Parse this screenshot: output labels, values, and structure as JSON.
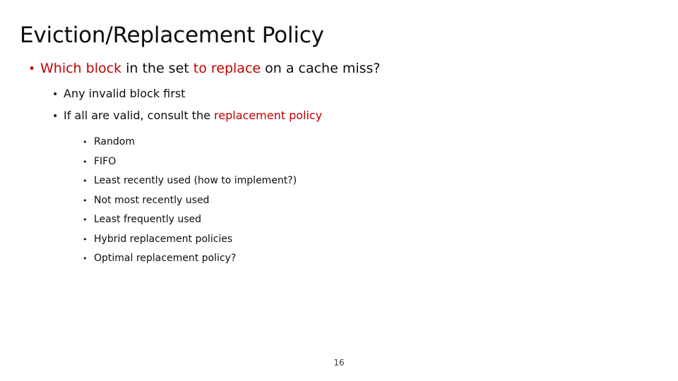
{
  "slide": {
    "title": "Eviction/Replacement Policy",
    "number": "16",
    "colors": {
      "accent_red": "#C00000",
      "text_black": "#0D0D0D",
      "background": "#FFFFFF"
    },
    "bullet_glyph": "•",
    "level1": {
      "marker": "•",
      "segments": {
        "part1": "Which block",
        "part2": " in the set ",
        "part3": "to replace",
        "part4": " on a cache miss?"
      }
    },
    "level2": [
      {
        "marker": "•",
        "segments": {
          "part1": "Any invalid block first",
          "part2": ""
        }
      },
      {
        "marker": "•",
        "segments": {
          "part1": "If all are valid, consult the ",
          "part2": "replacement policy"
        }
      }
    ],
    "level3": [
      {
        "marker": "•",
        "label": "Random"
      },
      {
        "marker": "•",
        "label": "FIFO"
      },
      {
        "marker": "•",
        "label": "Least recently used (how to implement?)"
      },
      {
        "marker": "•",
        "label": "Not most recently used"
      },
      {
        "marker": "•",
        "label": "Least frequently used"
      },
      {
        "marker": "•",
        "label": "Hybrid replacement policies"
      },
      {
        "marker": "•",
        "label": "Optimal replacement policy?"
      }
    ]
  }
}
